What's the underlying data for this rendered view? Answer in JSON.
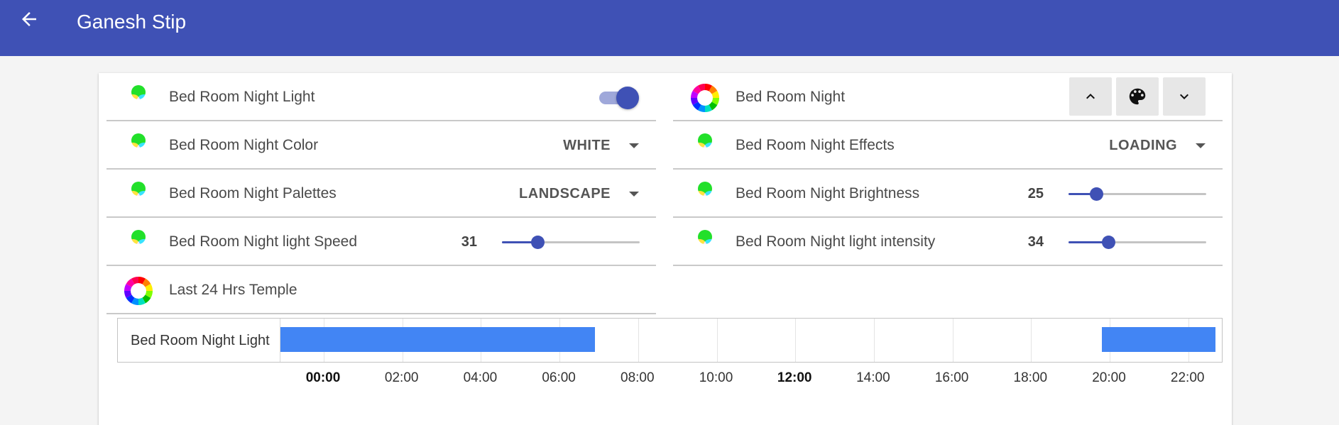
{
  "header": {
    "title": "Ganesh Stip",
    "back_icon": "arrow-left-icon",
    "background": "#3f51b5"
  },
  "rows_left": [
    {
      "label": "Bed Room Night Light",
      "icon": "rgb-circles-icon",
      "control": "toggle",
      "state": "on"
    },
    {
      "label": "Bed Room Night Color",
      "icon": "rgb-circles-icon",
      "control": "select",
      "value": "WHITE"
    },
    {
      "label": "Bed Room Night Palettes",
      "icon": "rgb-circles-icon",
      "control": "select",
      "value": "LANDSCAPE"
    },
    {
      "label": "Bed Room Night light Speed",
      "icon": "rgb-circles-icon",
      "control": "slider",
      "value": "31",
      "fraction": 0.26
    },
    {
      "label": "Last 24 Hrs Temple",
      "icon": "color-wheel-icon",
      "control": "none"
    }
  ],
  "rows_right": [
    {
      "label": "Bed Room Night",
      "icon": "color-wheel-icon",
      "control": "buttons",
      "buttons": [
        "chevron-up-icon",
        "palette-icon",
        "chevron-down-icon"
      ]
    },
    {
      "label": "Bed Room Night Effects",
      "icon": "rgb-circles-icon",
      "control": "select",
      "value": "LOADING"
    },
    {
      "label": "Bed Room Night Brightness",
      "icon": "rgb-circles-icon",
      "control": "slider",
      "value": "25",
      "fraction": 0.2
    },
    {
      "label": "Bed Room Night light intensity",
      "icon": "rgb-circles-icon",
      "control": "slider",
      "value": "34",
      "fraction": 0.29
    }
  ],
  "history": {
    "entity": "Bed Room Night Light",
    "bar_color": "#4285f4",
    "ticks": [
      {
        "label": "00:00",
        "bold": true
      },
      {
        "label": "02:00",
        "bold": false
      },
      {
        "label": "04:00",
        "bold": false
      },
      {
        "label": "06:00",
        "bold": false
      },
      {
        "label": "08:00",
        "bold": false
      },
      {
        "label": "10:00",
        "bold": false
      },
      {
        "label": "12:00",
        "bold": true
      },
      {
        "label": "14:00",
        "bold": false
      },
      {
        "label": "16:00",
        "bold": false
      },
      {
        "label": "18:00",
        "bold": false
      },
      {
        "label": "20:00",
        "bold": false
      },
      {
        "label": "22:00",
        "bold": false
      }
    ],
    "on_periods_hours": [
      [
        -1.3,
        6.9
      ],
      [
        19.8,
        22.7
      ]
    ]
  }
}
